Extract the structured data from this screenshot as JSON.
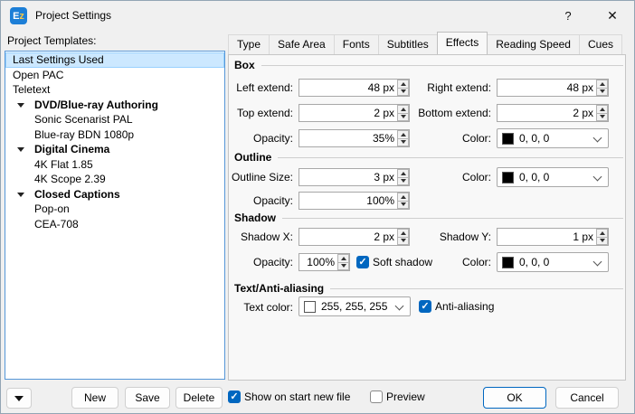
{
  "window": {
    "title": "Project Settings",
    "app_icon_text_1": "E",
    "app_icon_text_2": "z",
    "help_glyph": "?",
    "close_glyph": "✕"
  },
  "colors": {
    "accent": "#0067c0",
    "list_selection_bg": "#cce8ff",
    "box_color_hex": "#000000",
    "outline_color_hex": "#000000",
    "shadow_color_hex": "#000000",
    "text_color_hex": "#ffffff"
  },
  "left_panel": {
    "label": "Project Templates:",
    "items": [
      {
        "label": "Last Settings Used",
        "type": "item",
        "selected": true
      },
      {
        "label": "Open PAC",
        "type": "item",
        "selected": false
      },
      {
        "label": "Teletext",
        "type": "item",
        "selected": false
      },
      {
        "label": "DVD/Blue-ray Authoring",
        "type": "group",
        "selected": false
      },
      {
        "label": "Sonic Scenarist PAL",
        "type": "child",
        "selected": false
      },
      {
        "label": "Blue-ray BDN 1080p",
        "type": "child",
        "selected": false
      },
      {
        "label": "Digital Cinema",
        "type": "group",
        "selected": false
      },
      {
        "label": "4K Flat 1.85",
        "type": "child",
        "selected": false
      },
      {
        "label": "4K Scope 2.39",
        "type": "child",
        "selected": false
      },
      {
        "label": "Closed Captions",
        "type": "group",
        "selected": false
      },
      {
        "label": "Pop-on",
        "type": "child",
        "selected": false
      },
      {
        "label": "CEA-708",
        "type": "child",
        "selected": false
      }
    ]
  },
  "tabs": {
    "items": [
      "Type",
      "Safe Area",
      "Fonts",
      "Subtitles",
      "Effects",
      "Reading Speed",
      "Cues"
    ],
    "active": "Effects"
  },
  "effects": {
    "box": {
      "title": "Box",
      "left_extend_label": "Left extend:",
      "left_extend_value": "48 px",
      "right_extend_label": "Right extend:",
      "right_extend_value": "48 px",
      "top_extend_label": "Top extend:",
      "top_extend_value": "2 px",
      "bottom_extend_label": "Bottom extend:",
      "bottom_extend_value": "2 px",
      "opacity_label": "Opacity:",
      "opacity_value": "35%",
      "color_label": "Color:",
      "color_value": "0, 0, 0"
    },
    "outline": {
      "title": "Outline",
      "size_label": "Outline Size:",
      "size_value": "3 px",
      "color_label": "Color:",
      "color_value": "0, 0, 0",
      "opacity_label": "Opacity:",
      "opacity_value": "100%"
    },
    "shadow": {
      "title": "Shadow",
      "x_label": "Shadow X:",
      "x_value": "2 px",
      "y_label": "Shadow Y:",
      "y_value": "1 px",
      "opacity_label": "Opacity:",
      "opacity_value": "100%",
      "soft_shadow_label": "Soft shadow",
      "soft_shadow_checked": true,
      "color_label": "Color:",
      "color_value": "0, 0, 0"
    },
    "text": {
      "title": "Text/Anti-aliasing",
      "color_label": "Text color:",
      "color_value": "255, 255, 255",
      "anti_aliasing_label": "Anti-aliasing",
      "anti_aliasing_checked": true
    }
  },
  "footer": {
    "new": "New",
    "save": "Save",
    "delete": "Delete",
    "show_on_start_label": "Show on start new file",
    "show_on_start_checked": true,
    "preview_label": "Preview",
    "preview_checked": false,
    "ok": "OK",
    "cancel": "Cancel"
  }
}
